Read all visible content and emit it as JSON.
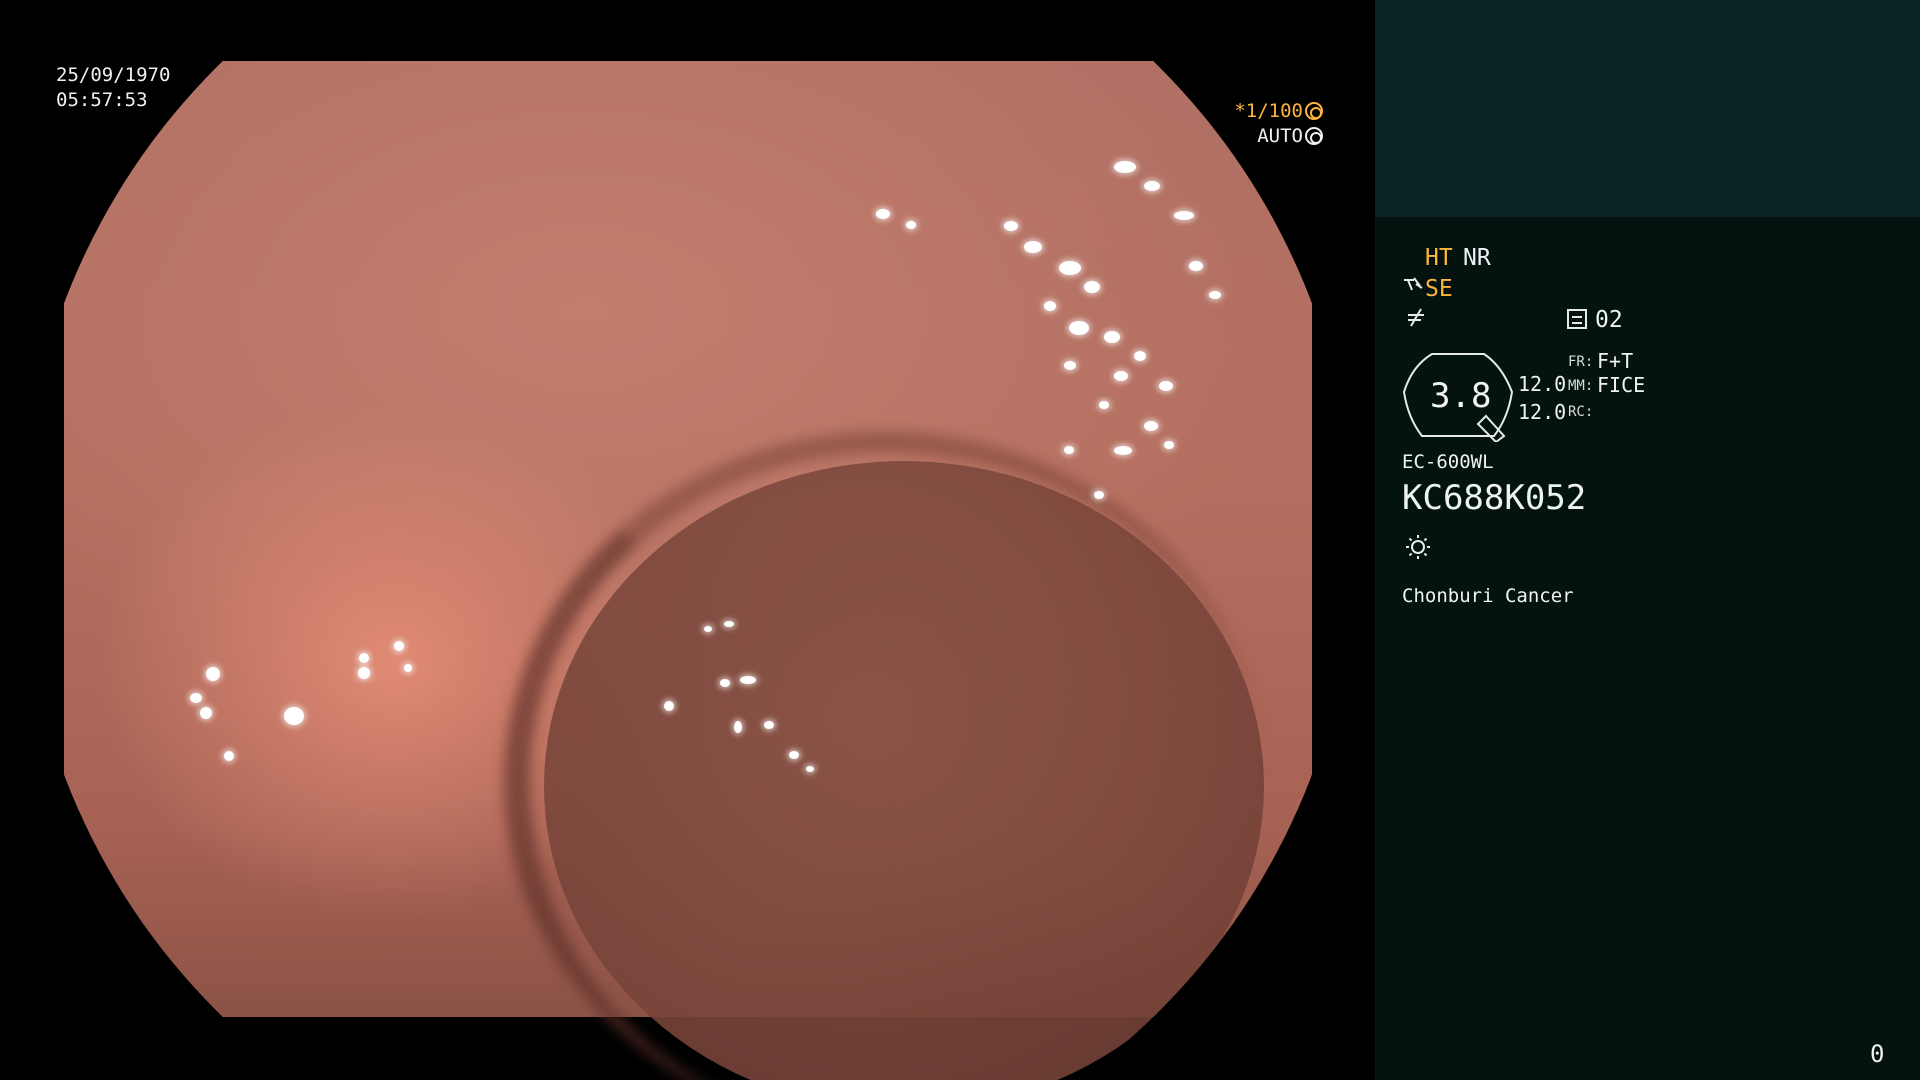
{
  "scope": {
    "date": "25/09/1970",
    "time": "05:57:53",
    "shutter_speed": "*1/100",
    "exposure_mode": "AUTO"
  },
  "panel": {
    "ht_label": "HT",
    "nr_label": "NR",
    "se_label": "SE",
    "memory_value": "02",
    "gauge_value": "3.8",
    "side_value_1": "12.0",
    "side_value_2": "12.0",
    "fr_label": "FR:",
    "fr_value": "F+T",
    "mm_label": "MM:",
    "mm_value": "FICE",
    "rc_label": "RC:",
    "scope_model": "EC-600WL",
    "serial_number": "KC688K052",
    "hospital": "Chonburi Cancer"
  },
  "counter": "0",
  "colors": {
    "accent_orange": "#ffb43c",
    "panel_bg": "#041310",
    "panel_top_bg": "#0b2424"
  },
  "icons": {
    "shutter": "aperture-icon",
    "auto": "iris-icon",
    "se": "scope-tip-icon",
    "slash": "slash-icon",
    "memory": "memory-icon",
    "light": "sun-icon"
  }
}
